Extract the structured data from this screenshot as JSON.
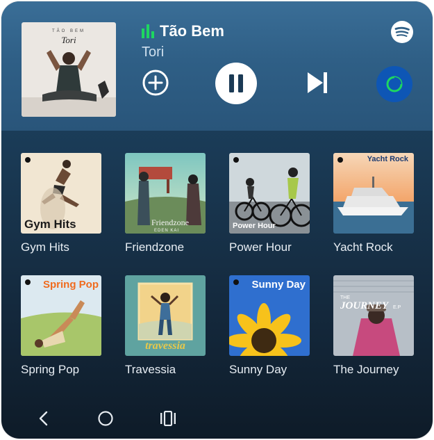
{
  "now_playing": {
    "title": "Tão Bem",
    "artist": "Tori",
    "album_art_text": "TÃO BEM",
    "album_signature": "Tori",
    "accent_color": "#1ed760"
  },
  "controls": {
    "add_icon": "add-circle-icon",
    "pause_icon": "pause-icon",
    "next_icon": "skip-next-icon",
    "connect_icon": "connect-device-icon"
  },
  "playlists": [
    {
      "label": "Gym Hits",
      "cover_text": "Gym Hits"
    },
    {
      "label": "Friendzone",
      "cover_text": "Friendzone",
      "cover_sub": "EDEN KAI"
    },
    {
      "label": "Power Hour",
      "cover_text": "Power Hour"
    },
    {
      "label": "Yacht Rock",
      "cover_text": "Yacht Rock"
    },
    {
      "label": "Spring Pop",
      "cover_text": "Spring Pop"
    },
    {
      "label": "Travessia",
      "cover_text": "travessia"
    },
    {
      "label": "Sunny Day",
      "cover_text": "Sunny Day"
    },
    {
      "label": "The Journey",
      "cover_text": "JOURNEY",
      "cover_pre": "THE",
      "cover_sub": "E.P"
    }
  ],
  "nav": {
    "back_icon": "back-chevron-icon",
    "home_icon": "home-circle-icon",
    "recents_icon": "recents-icon"
  }
}
